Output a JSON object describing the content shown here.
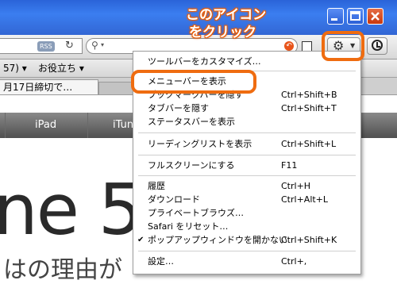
{
  "annotation": {
    "callout_line1": "このアイコン",
    "callout_line2": "をクリック",
    "accent_color": "#ef6c10"
  },
  "toolbar": {
    "rss_label": "RSS",
    "reload_icon": "reload-icon",
    "search_icon": "search-icon",
    "gear_icon": "gear-icon",
    "clock_icon": "history-icon"
  },
  "bookmarks": {
    "fragment_label": "57)",
    "favorites_label": "お役立ち"
  },
  "tab": {
    "active_label": "月17日締切で…"
  },
  "page": {
    "nav_ipad": "iPad",
    "nav_itunes": "iTun",
    "big_text": "ne 5",
    "sub_text": "はの理由が"
  },
  "menu": {
    "customize": "ツールバーをカスタマイズ…",
    "show_menubar": "メニューバーを表示",
    "hide_bookmarks": "ブックマークバーを隠す",
    "hide_bookmarks_sc": "Ctrl+Shift+B",
    "hide_tabbar": "タブバーを隠す",
    "hide_tabbar_sc": "Ctrl+Shift+T",
    "show_statusbar": "ステータスバーを表示",
    "show_readinglist": "リーディングリストを表示",
    "show_readinglist_sc": "Ctrl+Shift+L",
    "fullscreen": "フルスクリーンにする",
    "fullscreen_sc": "F11",
    "history": "履歴",
    "history_sc": "Ctrl+H",
    "downloads": "ダウンロード",
    "downloads_sc": "Ctrl+Alt+L",
    "private": "プライベートブラウズ…",
    "reset": "Safari をリセット…",
    "block_popups": "ポップアップウィンドウを開かない",
    "block_popups_sc": "Ctrl+Shift+K",
    "settings": "設定…",
    "settings_sc": "Ctrl+,"
  }
}
